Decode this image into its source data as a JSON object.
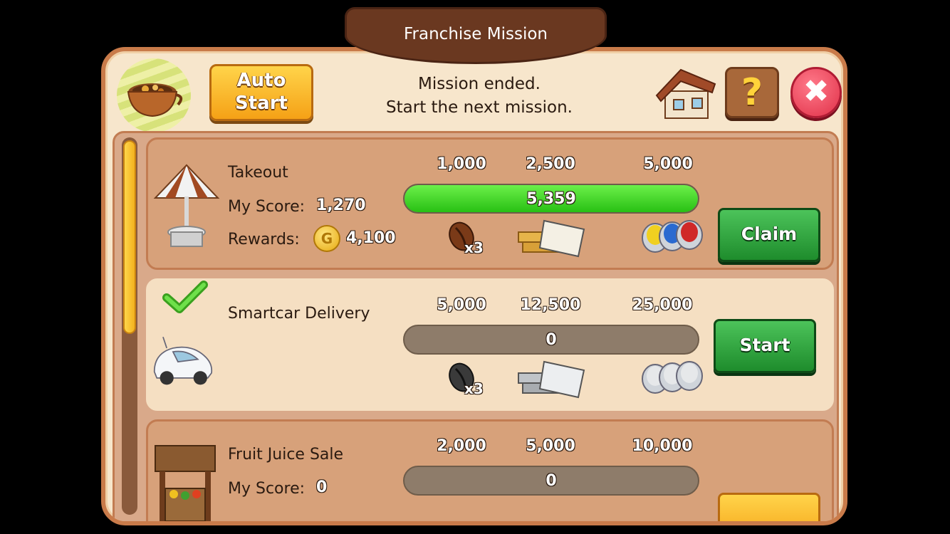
{
  "title": "Franchise Mission",
  "header": {
    "auto_start_line1": "Auto",
    "auto_start_line2": "Start",
    "status_line1": "Mission ended.",
    "status_line2": "Start the next mission.",
    "help_label": "?",
    "close_label": "✖"
  },
  "missions": [
    {
      "name": "Takeout",
      "score_label": "My Score:",
      "score": "1,270",
      "rewards_label": "Rewards:",
      "coin_letter": "G",
      "rewards": "4,100",
      "tiers": [
        "1,000",
        "2,500",
        "5,000"
      ],
      "progress_text": "5,359",
      "progress_fraction": 1.0,
      "multiplier": "x3",
      "action": "Claim"
    },
    {
      "name": "Smartcar Delivery",
      "completed": true,
      "tiers": [
        "5,000",
        "12,500",
        "25,000"
      ],
      "progress_text": "0",
      "progress_fraction": 0,
      "multiplier": "x3",
      "action": "Start"
    },
    {
      "name": "Fruit Juice Sale",
      "score_label": "My Score:",
      "score": "0",
      "tiers": [
        "2,000",
        "5,000",
        "10,000"
      ],
      "progress_text": "0",
      "progress_fraction": 0
    }
  ],
  "colors": {
    "panel_bg": "#f7e6cc",
    "panel_border": "#c97b4a",
    "title_bg": "#6a3820",
    "progress_green": "#28c014",
    "button_green": "#1e8c2c",
    "button_orange": "#f5a116",
    "close_red": "#e03048"
  },
  "scroll_position": 0.0
}
